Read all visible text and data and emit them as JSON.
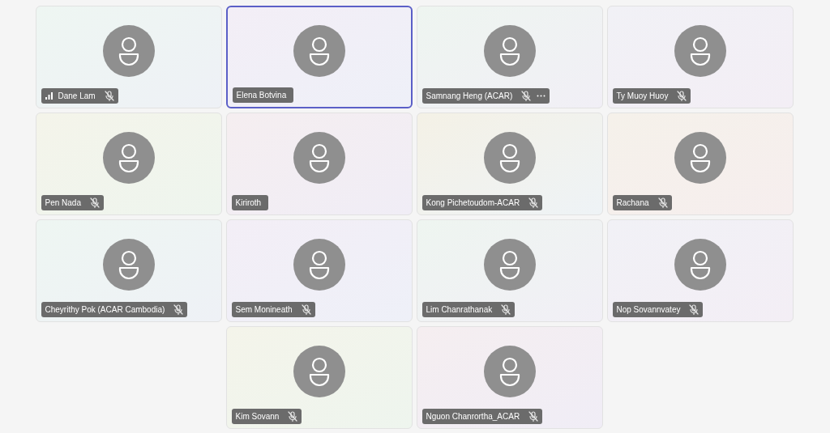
{
  "participants": [
    {
      "name": "Dane Lam",
      "muted": true,
      "speaking": false,
      "signal": true,
      "more": false
    },
    {
      "name": "Elena Botvina",
      "muted": false,
      "speaking": true,
      "signal": false,
      "more": false
    },
    {
      "name": "Samnang Heng (ACAR)",
      "muted": true,
      "speaking": false,
      "signal": false,
      "more": true
    },
    {
      "name": "Ty Muoy Huoy",
      "muted": true,
      "speaking": false,
      "signal": false,
      "more": false
    },
    {
      "name": "Pen Nada",
      "muted": true,
      "speaking": false,
      "signal": false,
      "more": false
    },
    {
      "name": "Kiriroth",
      "muted": false,
      "speaking": false,
      "signal": false,
      "more": false
    },
    {
      "name": "Kong Pichetoudom-ACAR",
      "muted": true,
      "speaking": false,
      "signal": false,
      "more": false
    },
    {
      "name": "Rachana",
      "muted": true,
      "speaking": false,
      "signal": false,
      "more": false
    },
    {
      "name": "Cheyrithy Pok (ACAR Cambodia)",
      "muted": true,
      "speaking": false,
      "signal": false,
      "more": false
    },
    {
      "name": "Sem Monineath",
      "muted": true,
      "speaking": false,
      "signal": false,
      "more": false
    },
    {
      "name": "Lim Chanrathanak",
      "muted": true,
      "speaking": false,
      "signal": false,
      "more": false
    },
    {
      "name": "Nop Sovannvatey",
      "muted": true,
      "speaking": false,
      "signal": false,
      "more": false
    },
    {
      "name": "Kim Sovann",
      "muted": true,
      "speaking": false,
      "signal": false,
      "more": false
    },
    {
      "name": "Nguon Chanrortha_ACAR",
      "muted": true,
      "speaking": false,
      "signal": false,
      "more": false
    }
  ]
}
